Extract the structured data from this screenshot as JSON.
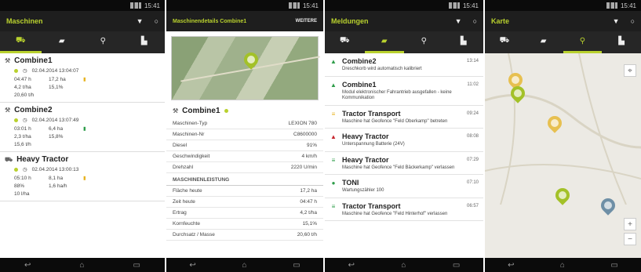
{
  "status": {
    "time": "15:41"
  },
  "p1": {
    "title": "Maschinen",
    "tabs": [
      "▣",
      "▤",
      "◉",
      "▥"
    ],
    "machines": [
      {
        "name": "Combine1",
        "date": "02.04.2014 13:04:07",
        "a": "04:47 h",
        "b": "17,2 ha",
        "c": "4,2 t/ha",
        "d": "15,1%",
        "e": "20,60 t/h"
      },
      {
        "name": "Combine2",
        "date": "02.04.2014 13:07:49",
        "a": "03:01 h",
        "b": "6,4 ha",
        "c": "2,3 t/ha",
        "d": "15,8%",
        "e": "15,6 t/h"
      },
      {
        "name": "Heavy Tractor",
        "date": "02.04.2014 13:00:13",
        "a": "05:10 h",
        "b": "8,1 ha",
        "c": "88%",
        "d": "1,6 ha/h",
        "e": "10 l/ha"
      }
    ]
  },
  "p2": {
    "title": "Maschinendetails Combine1",
    "action": "WEITERE",
    "machine_name": "Combine1",
    "rows": [
      {
        "k": "Maschinen-Typ",
        "v": "LEXION 780"
      },
      {
        "k": "Maschinen-Nr",
        "v": "C8600000"
      },
      {
        "k": "Diesel",
        "v": "91%"
      },
      {
        "k": "Geschwindigkeit",
        "v": "4 km/h"
      },
      {
        "k": "Drehzahl",
        "v": "2220 U/min"
      }
    ],
    "section": "MASCHINENLEISTUNG",
    "rows2": [
      {
        "k": "Fläche heute",
        "v": "17,2 ha"
      },
      {
        "k": "Zeit heute",
        "v": "04:47 h"
      },
      {
        "k": "Ertrag",
        "v": "4,2 t/ha"
      },
      {
        "k": "Kornfeuchte",
        "v": "15,1%"
      },
      {
        "k": "Durchsatz / Masse",
        "v": "20,60 t/h"
      }
    ]
  },
  "p3": {
    "title": "Meldungen",
    "messages": [
      {
        "name": "Combine2",
        "time": "13:14",
        "desc": "Dreschkorb wird automatisch kalibriert",
        "color": "#2e9d4a",
        "icon": "▲"
      },
      {
        "name": "Combine1",
        "time": "11:02",
        "desc": "Modul elektronischer Fahrantrieb ausgefallen - keine Kommunikation",
        "color": "#2e9d4a",
        "icon": "▲"
      },
      {
        "name": "Tractor Transport",
        "time": "09:24",
        "desc": "Maschine hat Geofence \"Feld Oberkamp\" betreten",
        "color": "#e7b321",
        "icon": "≡"
      },
      {
        "name": "Heavy Tractor",
        "time": "08:08",
        "desc": "Unterspannung Batterie (24V)",
        "color": "#c7262e",
        "icon": "▲"
      },
      {
        "name": "Heavy Tractor",
        "time": "07:29",
        "desc": "Maschine hat Geofence \"Feld Bäckerkamp\" verlassen",
        "color": "#2e9d4a",
        "icon": "≡"
      },
      {
        "name": "TONI",
        "time": "07:10",
        "desc": "Wartungszähler 100",
        "color": "#2e9d4a",
        "icon": "●"
      },
      {
        "name": "Tractor Transport",
        "time": "06:57",
        "desc": "Maschine hat Geofence \"Feld Hinterhof\" verlassen",
        "color": "#2e9d4a",
        "icon": "≡"
      }
    ]
  },
  "p4": {
    "title": "Karte"
  },
  "colors": {
    "accent": "#b9d12e",
    "green": "#2e9d4a",
    "yellow": "#e7b321",
    "red": "#c7262e",
    "blue": "#6e8fa6"
  }
}
